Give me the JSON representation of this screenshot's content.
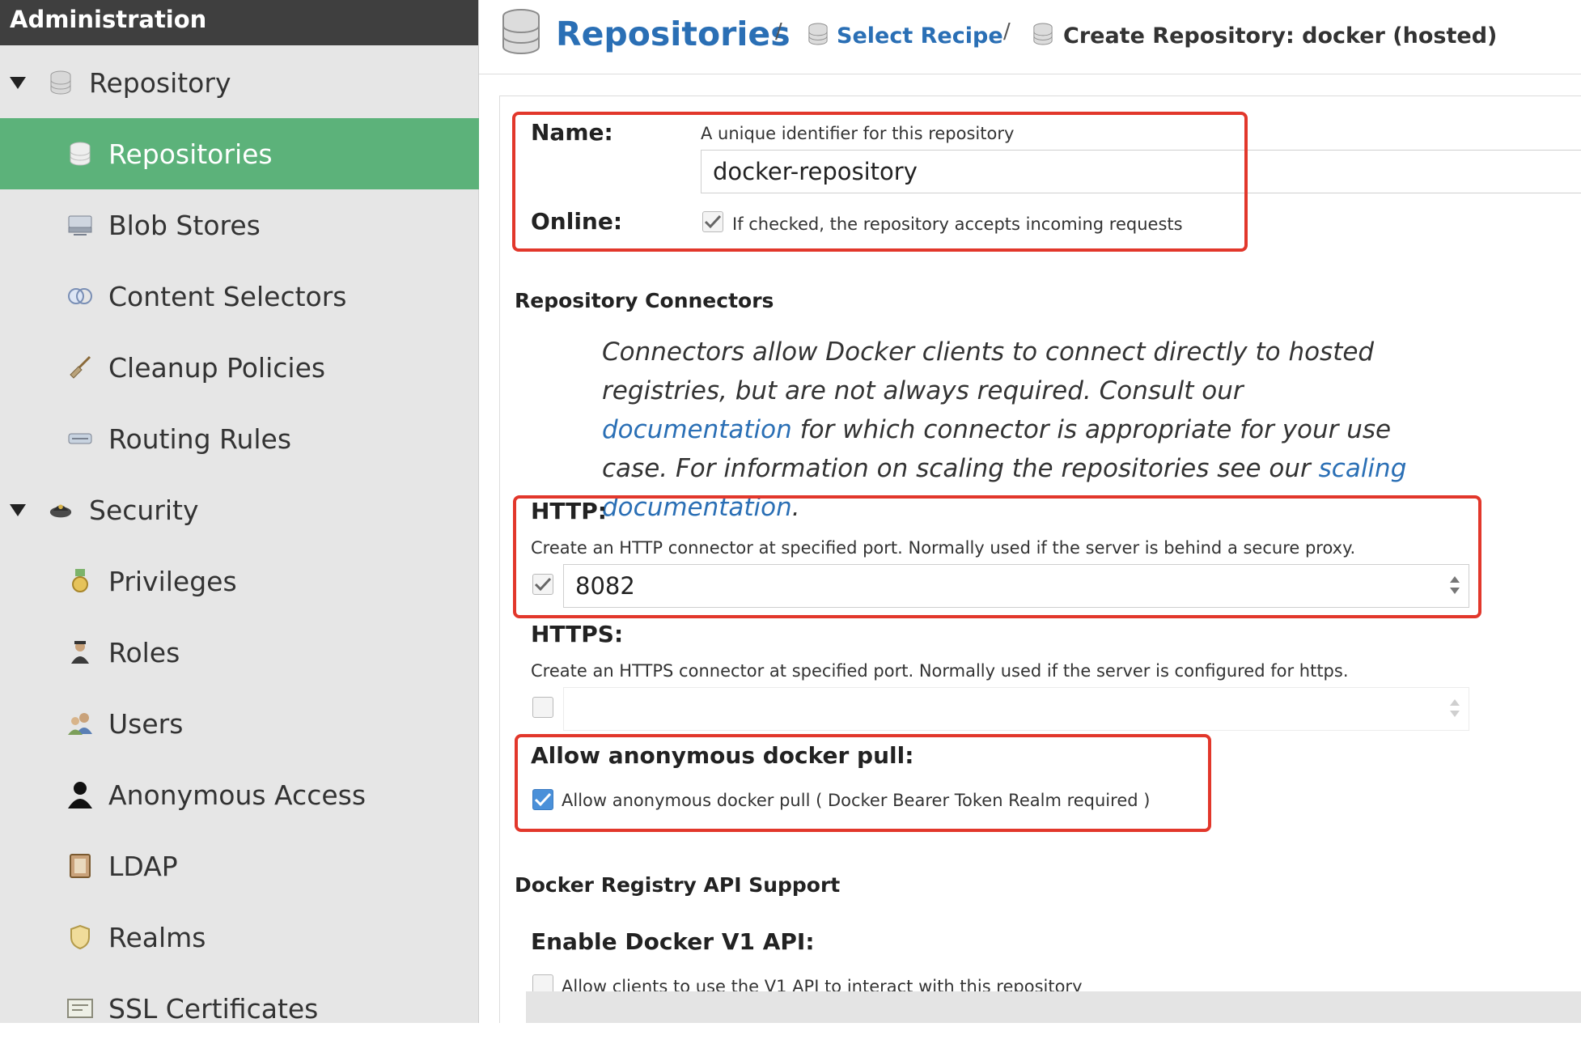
{
  "sidebar": {
    "title": "Administration",
    "groups": [
      {
        "label": "Repository",
        "items": [
          {
            "label": "Repositories",
            "icon": "database-icon"
          },
          {
            "label": "Blob Stores",
            "icon": "server-icon"
          },
          {
            "label": "Content Selectors",
            "icon": "content-selector-icon"
          },
          {
            "label": "Cleanup Policies",
            "icon": "broom-icon"
          },
          {
            "label": "Routing Rules",
            "icon": "routing-icon"
          }
        ]
      },
      {
        "label": "Security",
        "items": [
          {
            "label": "Privileges",
            "icon": "medal-icon"
          },
          {
            "label": "Roles",
            "icon": "role-icon"
          },
          {
            "label": "Users",
            "icon": "users-icon"
          },
          {
            "label": "Anonymous Access",
            "icon": "person-icon"
          },
          {
            "label": "LDAP",
            "icon": "ldap-book-icon"
          },
          {
            "label": "Realms",
            "icon": "shield-icon"
          },
          {
            "label": "SSL Certificates",
            "icon": "certificate-icon"
          }
        ]
      }
    ],
    "active_item": "Repositories"
  },
  "breadcrumb": {
    "title": "Repositories",
    "sep": "/",
    "link": "Select Recipe",
    "current": "Create Repository: docker (hosted)"
  },
  "form": {
    "name": {
      "label": "Name:",
      "help": "A unique identifier for this repository",
      "value": "docker-repository"
    },
    "online": {
      "label": "Online:",
      "help": "If checked, the repository accepts incoming requests",
      "checked": true
    },
    "connectors": {
      "title": "Repository Connectors",
      "desc_1": "Connectors allow Docker clients to connect directly to hosted registries, but are not always required. Consult our ",
      "doc_link": "documentation",
      "desc_2": " for which connector is appropriate for your use case. For information on scaling the repositories see our ",
      "scaling_link": "scaling documentation",
      "desc_3": "."
    },
    "http": {
      "label": "HTTP:",
      "help": "Create an HTTP connector at specified port. Normally used if the server is behind a secure proxy.",
      "checked": true,
      "port": "8082"
    },
    "https": {
      "label": "HTTPS:",
      "help": "Create an HTTPS connector at specified port. Normally used if the server is configured for https.",
      "checked": false,
      "port": ""
    },
    "anonymous": {
      "label": "Allow anonymous docker pull:",
      "help": "Allow anonymous docker pull ( Docker Bearer Token Realm required )",
      "checked": true
    },
    "api_support": {
      "title": "Docker Registry API Support"
    },
    "v1api": {
      "label": "Enable Docker V1 API:",
      "help": "Allow clients to use the V1 API to interact with this repository",
      "checked": false
    }
  },
  "colors": {
    "active_nav": "#5cb27a",
    "link": "#2a6fb5",
    "highlight_box": "#e2372b"
  }
}
